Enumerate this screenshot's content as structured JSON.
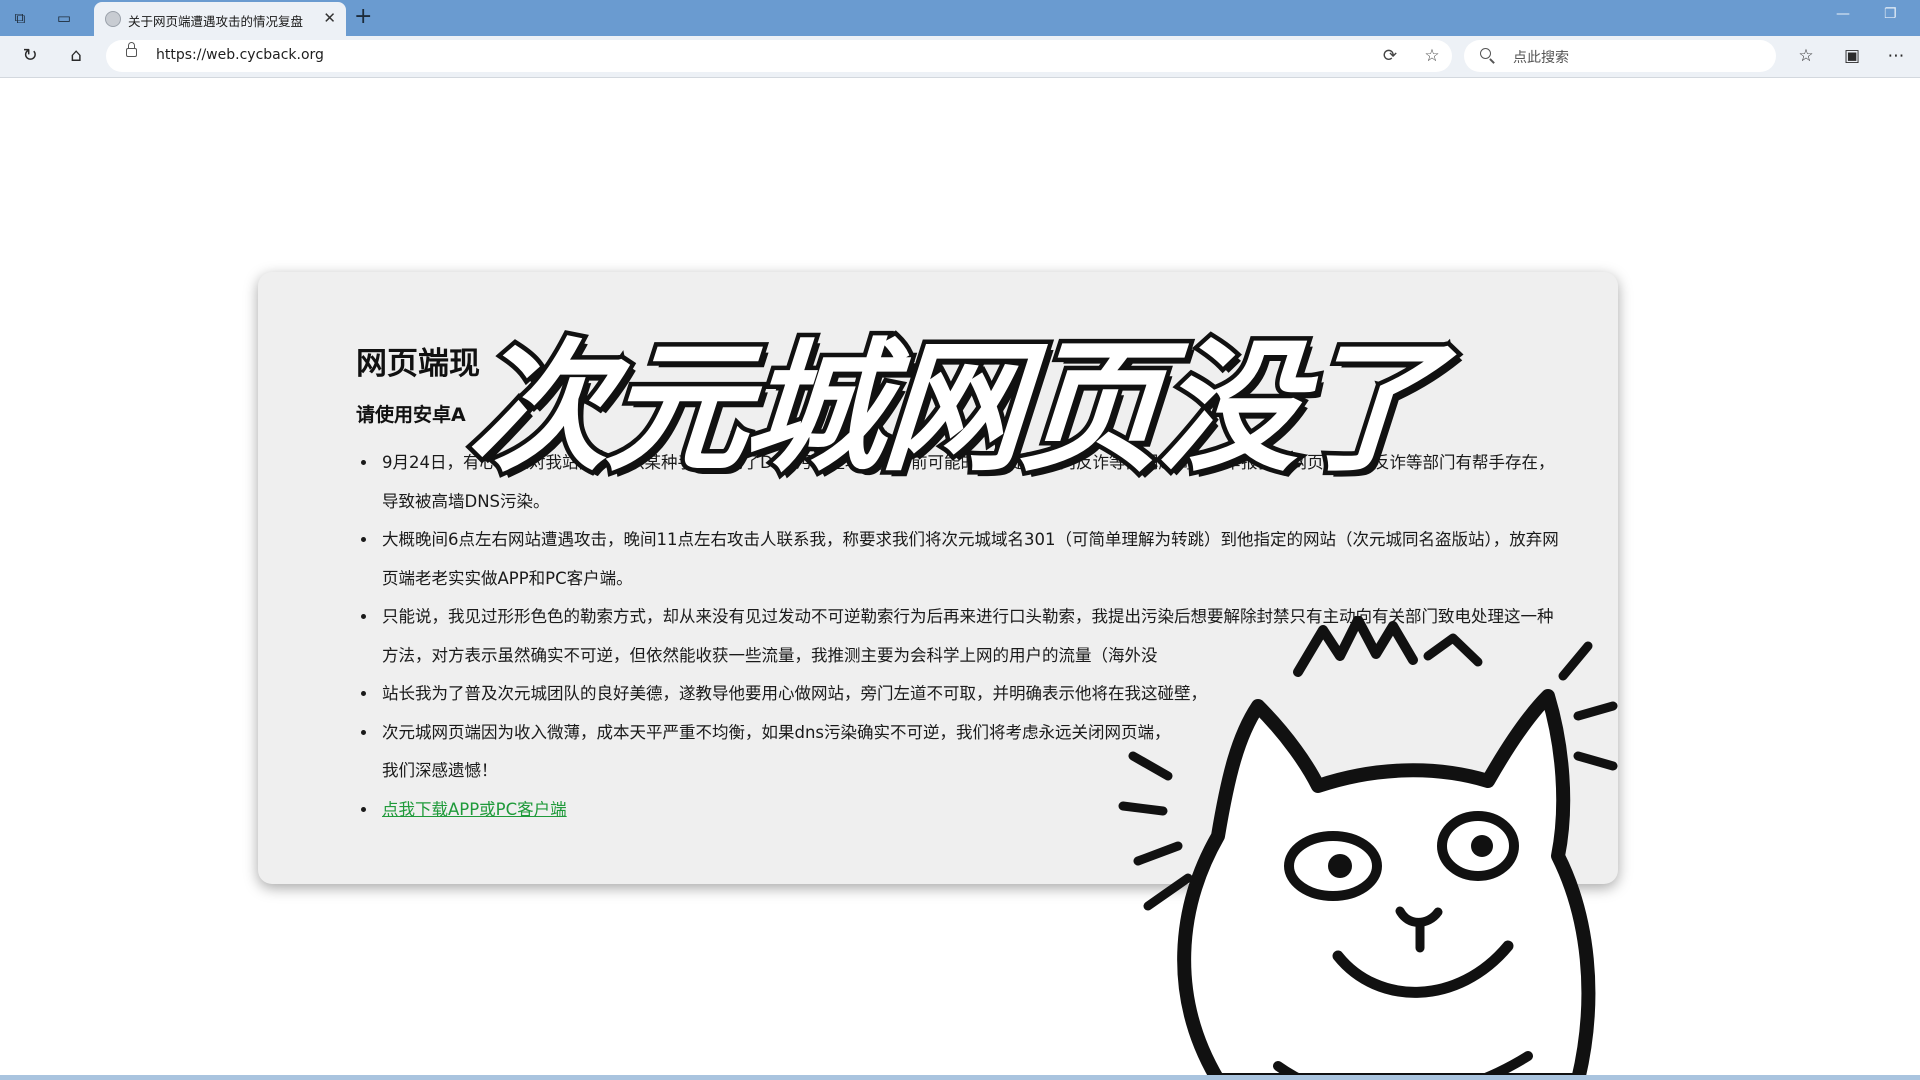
{
  "tab": {
    "title": "关于网页端遭遇攻击的情况复盘"
  },
  "address_bar": {
    "url": "https://web.cycback.org"
  },
  "search": {
    "placeholder": "点此搜索"
  },
  "page": {
    "heading": "网页端现",
    "subheading": "请使用安卓A",
    "bullets": [
      "9月24日，有心之人对我站网页端以某种手段发动了DNS污染型攻击，目前可能的手段是通过向反诈等部门超高频率举报我站网页端或在反诈等部门有帮手存在，导致被高墙DNS污染。",
      "大概晚间6点左右网站遭遇攻击，晚间11点左右攻击人联系我，称要求我们将次元城域名301（可简单理解为转跳）到他指定的网站（次元城同名盗版站），放弃网页端老老实实做APP和PC客户端。",
      "只能说，我见过形形色色的勒索方式，却从来没有见过发动不可逆勒索行为后再来进行口头勒索，我提出污染后想要解除封禁只有主动向有关部门致电处理这一种方法，对方表示虽然确实不可逆，但依然能收获一些流量，我推测主要为会科学上网的用户的流量（海外没",
      "站长我为了普及次元城团队的良好美德，遂教导他要用心做网站，旁门左道不可取，并明确表示他将在我这碰壁，",
      "次元城网页端因为收入微薄，成本天平严重不均衡，如果dns污染确实不可逆，我们将考虑永远关闭网页端，",
      "我们深感遗憾！"
    ],
    "download_link": "点我下载APP或PC客户端"
  },
  "overlay": {
    "title": "次元城网页没了"
  },
  "colors": {
    "titlebar": "#6a9bd0",
    "toolbar": "#edf1f6",
    "card": "#efefef",
    "link": "#1f9a3a"
  },
  "icons": [
    "collections-icon",
    "tab-actions-icon",
    "refresh-icon",
    "home-icon",
    "lock-icon",
    "read-aloud-icon",
    "favorite-star-icon",
    "search-icon",
    "favorites-icon",
    "collections-toolbar-icon",
    "more-icon"
  ]
}
